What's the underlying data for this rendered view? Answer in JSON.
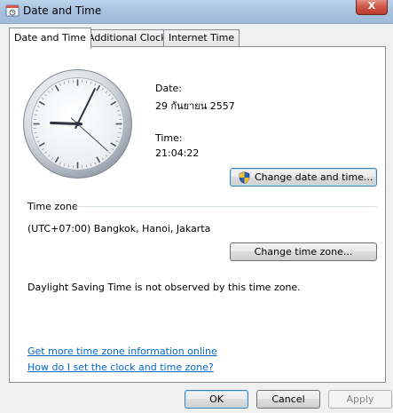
{
  "window": {
    "title": "Date and Time",
    "close_glyph": "X"
  },
  "tabs": [
    {
      "label": "Date and Time",
      "active": true
    },
    {
      "label": "Additional Clocks",
      "active": false
    },
    {
      "label": "Internet Time",
      "active": false
    }
  ],
  "clock": {
    "hour": 21,
    "minute": 4,
    "second": 22
  },
  "date": {
    "label": "Date:",
    "value": "29 กันยายน 2557"
  },
  "time": {
    "label": "Time:",
    "value": "21:04:22"
  },
  "change_datetime_button": {
    "label": "Change date and time...",
    "icon": "uac-shield-icon"
  },
  "timezone": {
    "group_label": "Time zone",
    "value": "(UTC+07:00) Bangkok, Hanoi, Jakarta",
    "change_button": "Change time zone...",
    "dst_note": "Daylight Saving Time is not observed by this time zone."
  },
  "links": {
    "more_info": "Get more time zone information online",
    "how_to": "How do I set the clock and time zone?"
  },
  "footer": {
    "ok": "OK",
    "cancel": "Cancel",
    "apply": "Apply"
  },
  "colors": {
    "link": "#0066cc",
    "close_button": "#c94a3c",
    "title_glass": "#a7c1de"
  }
}
